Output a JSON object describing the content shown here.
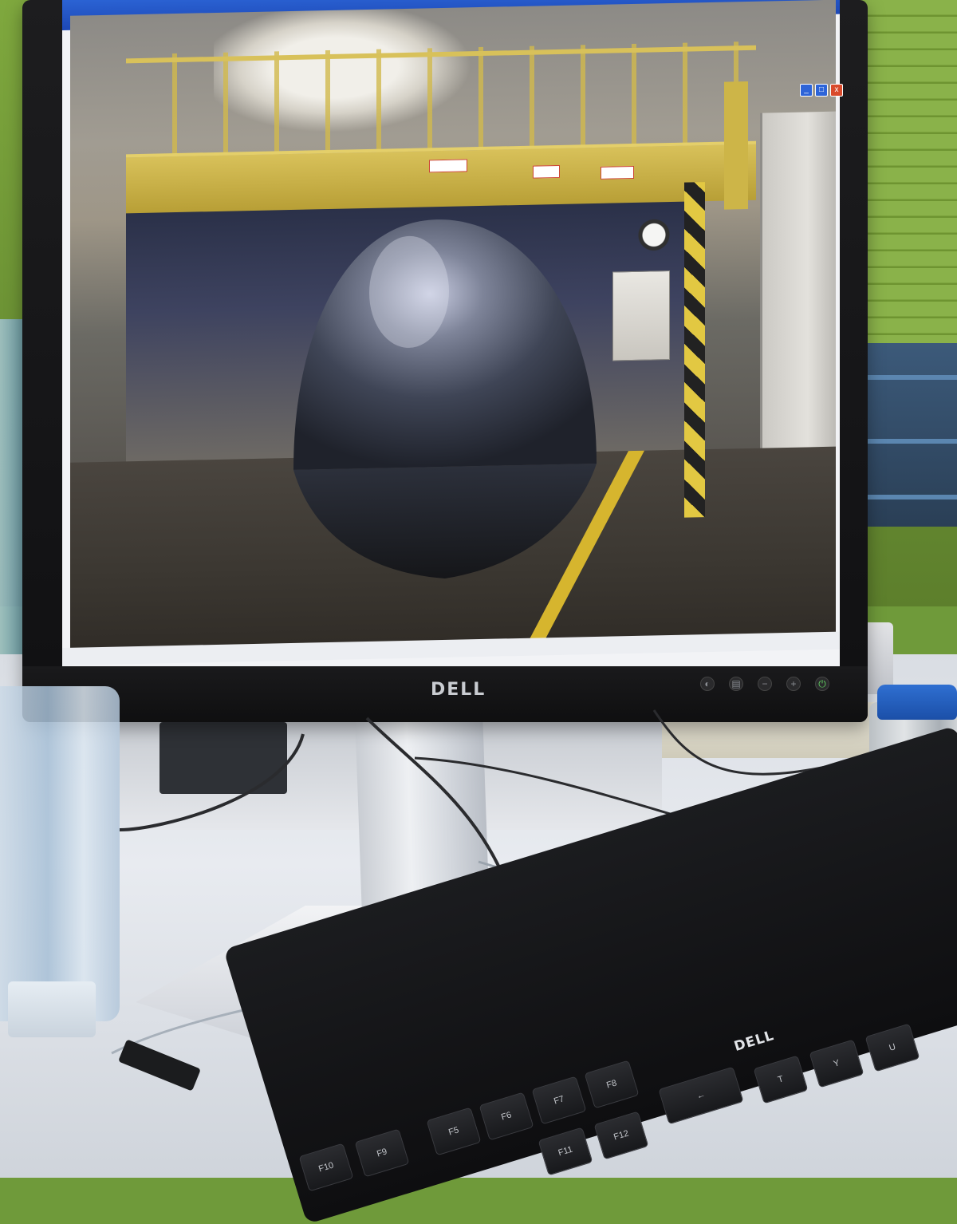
{
  "screen_window": {
    "title": "",
    "menu": "",
    "controls": {
      "minimize": "_",
      "maximize": "□",
      "close": "x"
    },
    "status_segments": [
      "",
      "",
      "",
      "",
      "",
      ""
    ]
  },
  "monitor": {
    "brand": "DELL",
    "buttons": [
      "◐",
      "▤",
      "−",
      "+",
      "⏻"
    ]
  },
  "keyboard": {
    "brand": "DELL",
    "keys": [
      "F5",
      "F6",
      "F7",
      "F8",
      "F9",
      "F10",
      "F11",
      "F12",
      "←",
      "T",
      "Y",
      "U"
    ]
  },
  "colors": {
    "wall": "#7fa83e",
    "screen_titlebar": "#2b63d4",
    "dome": "#39424f",
    "safety_yellow": "#d8c15a",
    "jar_lid": "#2f6fd1"
  },
  "icons": {
    "minimize": "minimize-icon",
    "maximize": "maximize-icon",
    "close": "close-icon",
    "power": "power-icon"
  }
}
